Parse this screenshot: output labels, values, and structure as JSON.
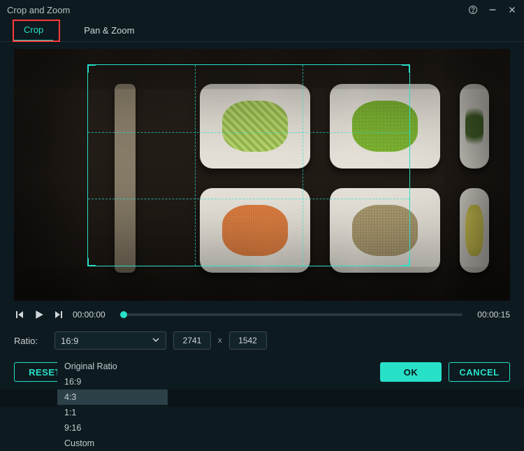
{
  "window": {
    "title": "Crop and Zoom"
  },
  "tabs": {
    "crop": "Crop",
    "panzoom": "Pan & Zoom"
  },
  "playback": {
    "current": "00:00:00",
    "duration": "00:00:15"
  },
  "ratio": {
    "label": "Ratio:",
    "selected": "16:9",
    "width": "2741",
    "height": "1542",
    "options": [
      "Original Ratio",
      "16:9",
      "4:3",
      "1:1",
      "9:16",
      "Custom"
    ],
    "hovered": "4:3"
  },
  "buttons": {
    "reset": "RESET",
    "ok": "OK",
    "cancel": "CANCEL"
  }
}
